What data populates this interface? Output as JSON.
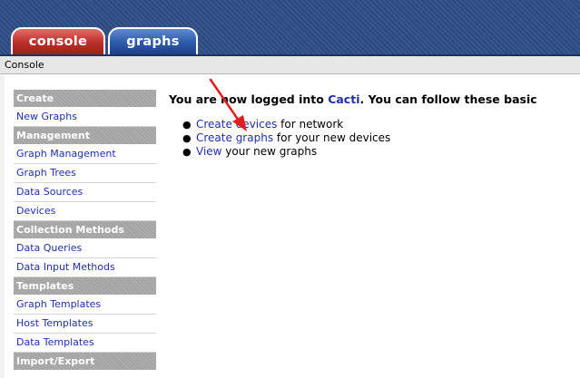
{
  "tabs": [
    {
      "label": "console"
    },
    {
      "label": "graphs"
    }
  ],
  "breadcrumb": "Console",
  "sidebar": {
    "sections": [
      {
        "header": "Create",
        "items": [
          "New Graphs"
        ]
      },
      {
        "header": "Management",
        "items": [
          "Graph Management",
          "Graph Trees",
          "Data Sources",
          "Devices"
        ]
      },
      {
        "header": "Collection Methods",
        "items": [
          "Data Queries",
          "Data Input Methods"
        ]
      },
      {
        "header": "Templates",
        "items": [
          "Graph Templates",
          "Host Templates",
          "Data Templates"
        ]
      },
      {
        "header": "Import/Export",
        "items": []
      }
    ]
  },
  "main": {
    "welcome": {
      "prefix": "You are now logged into ",
      "link": "Cacti",
      "suffix": ". You can follow these basic"
    },
    "steps": [
      {
        "link": "Create devices",
        "text": " for network"
      },
      {
        "link": "Create graphs",
        "text": " for your new devices"
      },
      {
        "link": "View",
        "text": " your new graphs"
      }
    ]
  },
  "colors": {
    "tab_console": "#c4413c",
    "tab_graphs": "#2d5aa8",
    "tabbar_bg": "#2b4a82",
    "menu_header_bg": "#a3a3a3",
    "link": "#1f2fa8",
    "annotation": "#e01e1e"
  },
  "annotation": {
    "type": "arrow",
    "points_to": "Create devices"
  }
}
